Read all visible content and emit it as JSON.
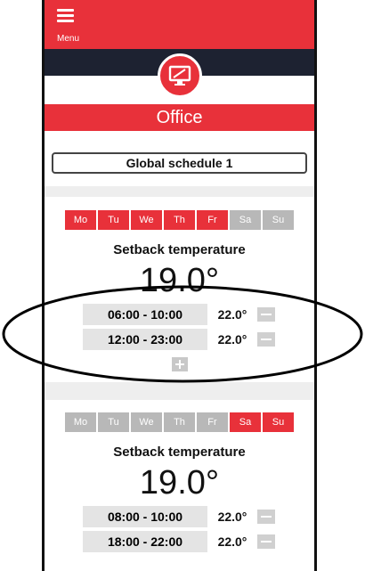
{
  "header": {
    "menu_label": "Menu",
    "room_title": "Office",
    "room_icon": "display-icon"
  },
  "schedule": {
    "selected": "Global schedule 1"
  },
  "blocks": [
    {
      "days": [
        {
          "label": "Mo",
          "active": true
        },
        {
          "label": "Tu",
          "active": true
        },
        {
          "label": "We",
          "active": true
        },
        {
          "label": "Th",
          "active": true
        },
        {
          "label": "Fr",
          "active": true
        },
        {
          "label": "Sa",
          "active": false
        },
        {
          "label": "Su",
          "active": false
        }
      ],
      "setback_label": "Setback temperature",
      "setback_value": "19.0°",
      "slots": [
        {
          "time": "06:00 - 10:00",
          "temp": "22.0°"
        },
        {
          "time": "12:00 - 23:00",
          "temp": "22.0°"
        }
      ]
    },
    {
      "days": [
        {
          "label": "Mo",
          "active": false
        },
        {
          "label": "Tu",
          "active": false
        },
        {
          "label": "We",
          "active": false
        },
        {
          "label": "Th",
          "active": false
        },
        {
          "label": "Fr",
          "active": false
        },
        {
          "label": "Sa",
          "active": true
        },
        {
          "label": "Su",
          "active": true
        }
      ],
      "setback_label": "Setback temperature",
      "setback_value": "19.0°",
      "slots": [
        {
          "time": "08:00 - 10:00",
          "temp": "22.0°"
        },
        {
          "time": "18:00 - 22:00",
          "temp": "22.0°"
        }
      ]
    }
  ],
  "colors": {
    "accent": "#e8313a",
    "dark_band": "#1d2231",
    "day_off": "#b8b8b8",
    "slot_bg": "#e4e4e4"
  }
}
